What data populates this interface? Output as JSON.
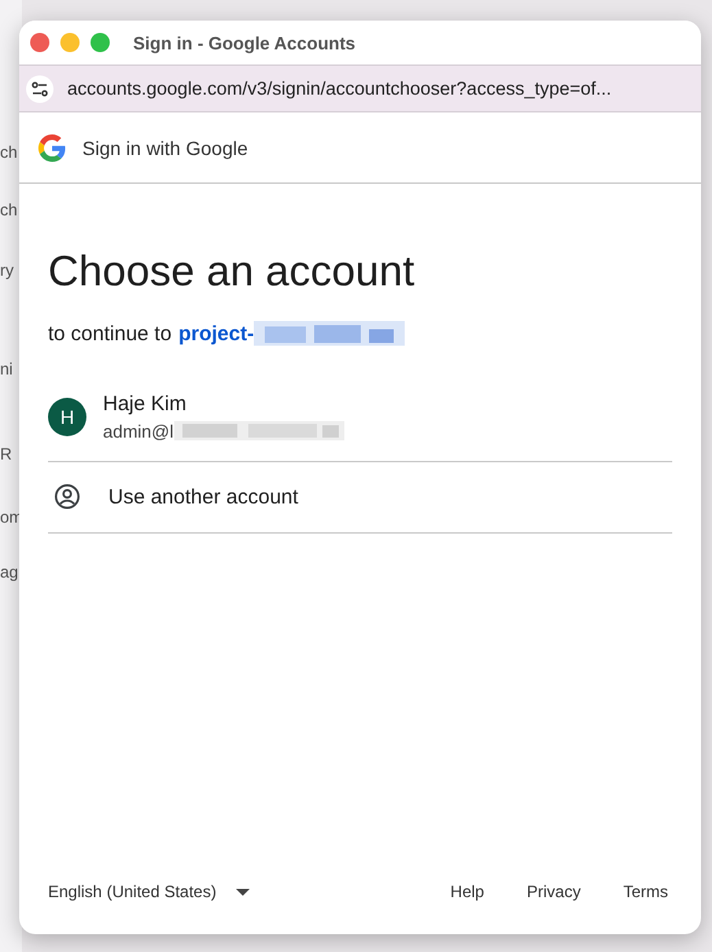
{
  "background": {
    "fragments": [
      "ch",
      "ch",
      "ry",
      "ni",
      "R",
      "om",
      "ag"
    ]
  },
  "window": {
    "title": "Sign in - Google Accounts",
    "url": "accounts.google.com/v3/signin/accountchooser?access_type=of..."
  },
  "header": {
    "title": "Sign in with Google"
  },
  "heading": "Choose an account",
  "subtitle": {
    "text": "to continue to",
    "project": "project-"
  },
  "accounts": [
    {
      "kind": "account",
      "initial": "H",
      "name": "Haje Kim",
      "email": "admin@l",
      "color": "#0b5a45"
    },
    {
      "kind": "other",
      "name": "Use another account"
    }
  ],
  "footer": {
    "language": "English (United States)",
    "links": [
      "Help",
      "Privacy",
      "Terms"
    ]
  }
}
